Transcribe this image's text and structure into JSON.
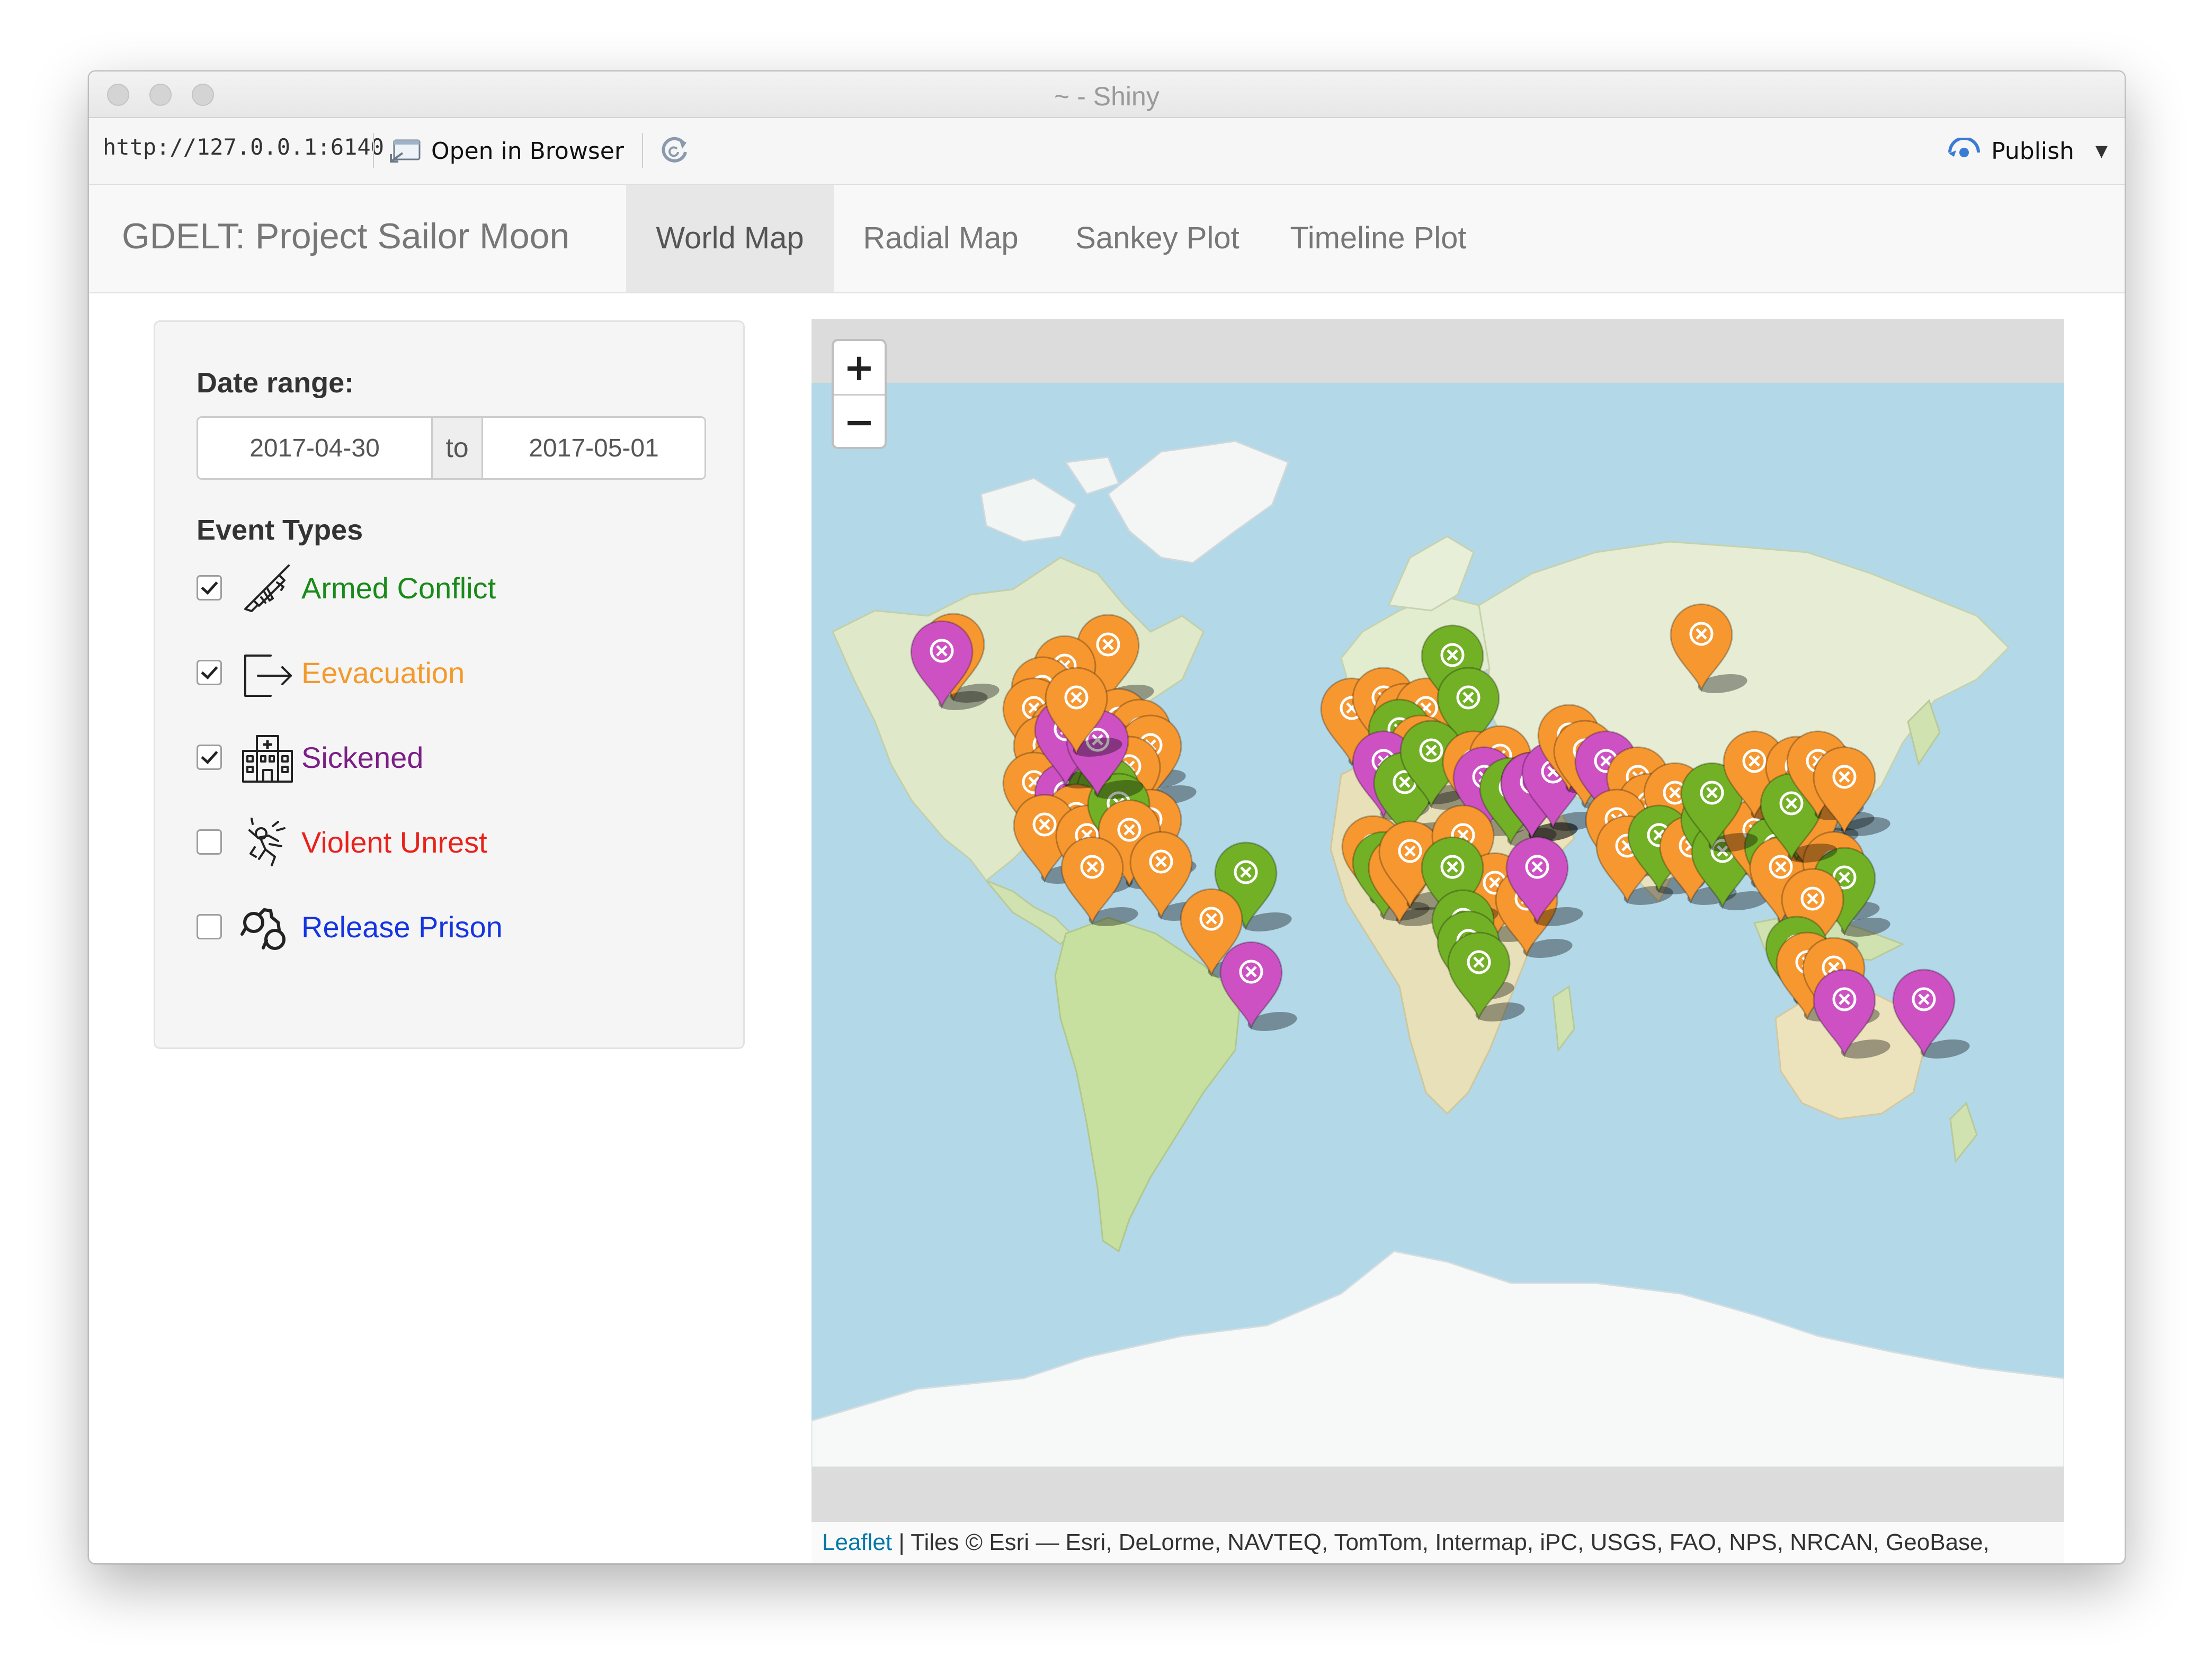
{
  "window": {
    "title": "~ - Shiny"
  },
  "toolbar": {
    "url": "http://127.0.0.1:6140",
    "open_in_browser": "Open in Browser",
    "publish": "Publish"
  },
  "navbar": {
    "brand": "GDELT: Project Sailor Moon",
    "tabs": [
      {
        "label": "World Map",
        "active": true
      },
      {
        "label": "Radial Map",
        "active": false
      },
      {
        "label": "Sankey Plot",
        "active": false
      },
      {
        "label": "Timeline Plot",
        "active": false
      }
    ]
  },
  "sidebar": {
    "date_range_label": "Date range:",
    "date_start": "2017-04-30",
    "date_separator": "to",
    "date_end": "2017-05-01",
    "event_types_label": "Event Types",
    "events": [
      {
        "label": "Armed Conflict",
        "checked": true,
        "color": "#1a8a1a",
        "icon": "rifle-icon"
      },
      {
        "label": "Eevacuation",
        "checked": true,
        "color": "#f39a2c",
        "icon": "exit-icon"
      },
      {
        "label": "Sickened",
        "checked": true,
        "color": "#7b1f86",
        "icon": "hospital-icon"
      },
      {
        "label": "Violent Unrest",
        "checked": false,
        "color": "#e8221b",
        "icon": "riot-icon"
      },
      {
        "label": "Release Prison",
        "checked": false,
        "color": "#1535e0",
        "icon": "handcuffs-icon"
      }
    ]
  },
  "map": {
    "zoom_in": "+",
    "zoom_out": "−",
    "attribution_link": "Leaflet",
    "attribution_text": " | Tiles © Esri — Esri, DeLorme, NAVTEQ, TomTom, Intermap, iPC, USGS, FAO, NPS, NRCAN, GeoBase,",
    "marker_colors": {
      "green": "#72b026",
      "orange": "#f69730",
      "magenta": "#cd51c3"
    }
  }
}
